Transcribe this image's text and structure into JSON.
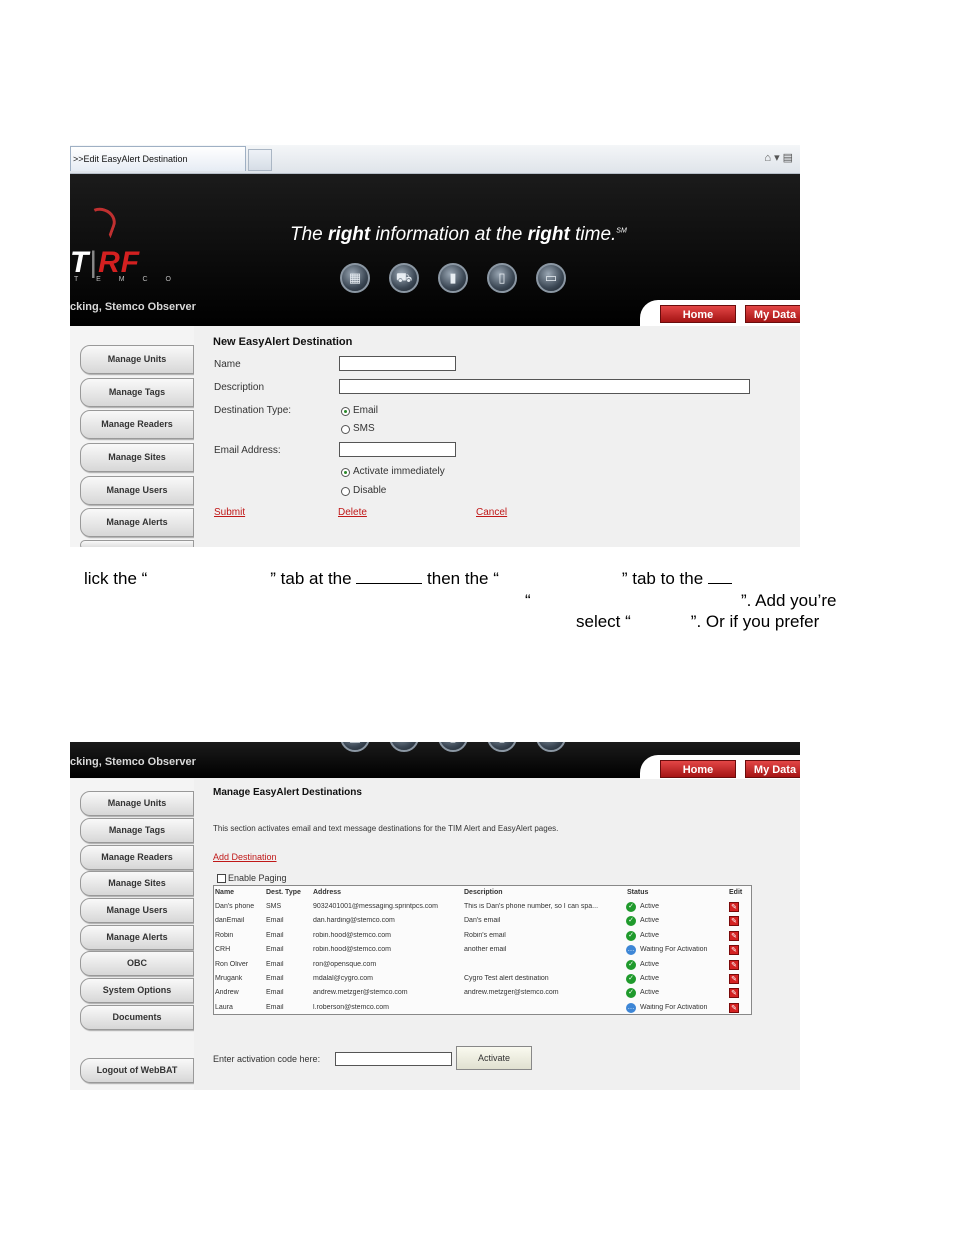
{
  "screenshot1": {
    "browser_tab_title": ">>Edit EasyAlert Destination",
    "toolbar_icons": [
      "home-icon",
      "dropdown-icon",
      "feed-icon"
    ],
    "tagline_parts": [
      "The ",
      "right",
      " information at the ",
      "right",
      " time.",
      "SM"
    ],
    "logo_left": "T",
    "logo_right": "RF",
    "logo_sub": "T E M C O",
    "observer_text": "cking, Stemco Observer",
    "nav_buttons": [
      "Home",
      "My Data"
    ],
    "sidebar": [
      "Manage Units",
      "Manage Tags",
      "Manage Readers",
      "Manage Sites",
      "Manage Users",
      "Manage Alerts"
    ],
    "form": {
      "title": "New EasyAlert Destination",
      "name_label": "Name",
      "name_value": "",
      "description_label": "Description",
      "description_value": "",
      "destination_type_label": "Destination Type:",
      "type_options": [
        "Email",
        "SMS"
      ],
      "email_label": "Email Address:",
      "email_value": "",
      "activation_options": [
        "Activate immediately",
        "Disable"
      ],
      "links": [
        "Submit",
        "Delete",
        "Cancel"
      ]
    }
  },
  "doc_text": {
    "line1": [
      "lick the “",
      "” tab at the",
      "then the “",
      "” tab to the"
    ],
    "line2_quote": "“",
    "line2_tail": "”. Add you’re",
    "line3": [
      "select “",
      "”.  Or if you prefer"
    ]
  },
  "screenshot2": {
    "observer_text": "cking, Stemco Observer",
    "nav_buttons": [
      "Home",
      "My Data"
    ],
    "sidebar": [
      "Manage Units",
      "Manage Tags",
      "Manage Readers",
      "Manage Sites",
      "Manage Users",
      "Manage Alerts",
      "OBC",
      "System Options",
      "Documents"
    ],
    "logout": "Logout of WebBAT",
    "title": "Manage EasyAlert Destinations",
    "intro": "This section activates email and text message destinations for the TIM Alert and EasyAlert pages.",
    "add_link": "Add Destination",
    "paging_label": "Enable Paging",
    "columns": [
      "Name",
      "Dest. Type",
      "Address",
      "Description",
      "Status",
      "Edit"
    ],
    "rows": [
      {
        "name": "Dan's phone",
        "type": "SMS",
        "address": "9032401001@messaging.sprintpcs.com",
        "description": "This is Dan's phone number, so I can spa...",
        "status": "Active"
      },
      {
        "name": "danEmail",
        "type": "Email",
        "address": "dan.harding@stemco.com",
        "description": "Dan's email",
        "status": "Active"
      },
      {
        "name": "Robin",
        "type": "Email",
        "address": "robin.hood@stemco.com",
        "description": "Robin's email",
        "status": "Active"
      },
      {
        "name": "CRH",
        "type": "Email",
        "address": "robin.hood@stemco.com",
        "description": "another email",
        "status": "Waiting For Activation"
      },
      {
        "name": "Ron Oliver",
        "type": "Email",
        "address": "ron@opensque.com",
        "description": "",
        "status": "Active"
      },
      {
        "name": "Mrugank",
        "type": "Email",
        "address": "mdalal@cygro.com",
        "description": "Cygro Test alert destination",
        "status": "Active"
      },
      {
        "name": "Andrew",
        "type": "Email",
        "address": "andrew.metzger@stemco.com",
        "description": "andrew.metzger@stemco.com",
        "status": "Active"
      },
      {
        "name": "Laura",
        "type": "Email",
        "address": "l.roberson@stemco.com",
        "description": "",
        "status": "Waiting For Activation"
      }
    ],
    "activation_label": "Enter activation code here:",
    "activation_value": "",
    "activate_button": "Activate"
  }
}
